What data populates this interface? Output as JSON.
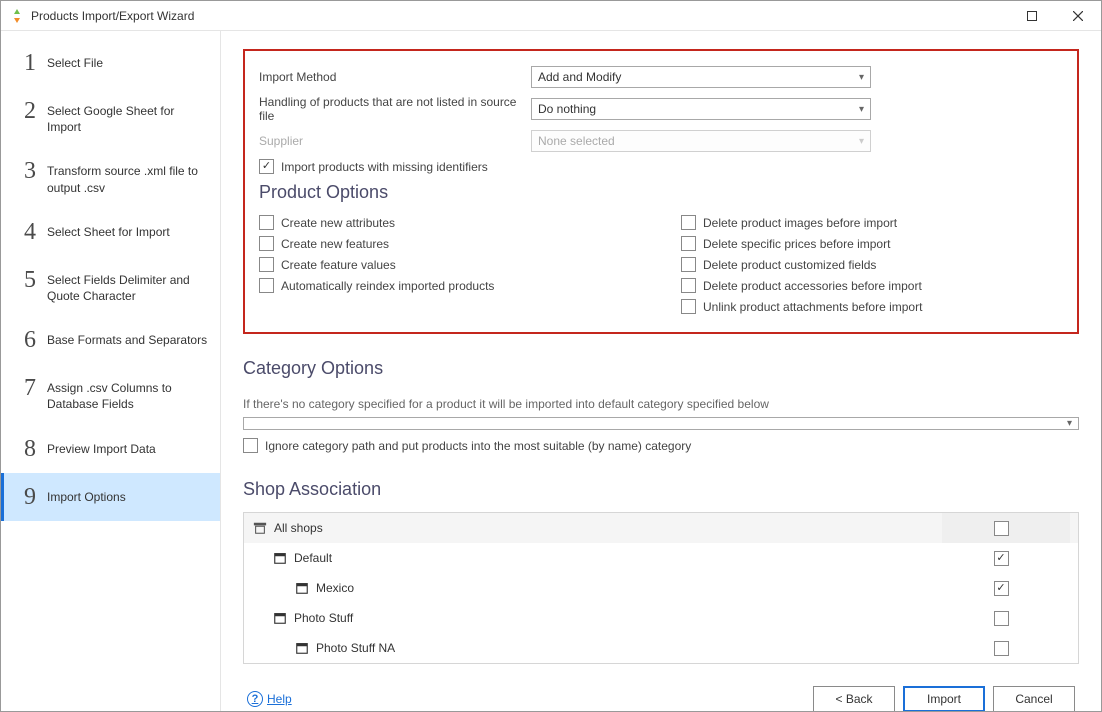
{
  "window": {
    "title": "Products Import/Export Wizard"
  },
  "steps": [
    {
      "num": "1",
      "label": "Select File"
    },
    {
      "num": "2",
      "label": "Select Google Sheet for Import"
    },
    {
      "num": "3",
      "label": "Transform source .xml file to output .csv"
    },
    {
      "num": "4",
      "label": "Select Sheet for Import"
    },
    {
      "num": "5",
      "label": "Select Fields Delimiter and Quote Character"
    },
    {
      "num": "6",
      "label": "Base Formats and Separators"
    },
    {
      "num": "7",
      "label": "Assign .csv Columns to Database Fields"
    },
    {
      "num": "8",
      "label": "Preview Import Data"
    },
    {
      "num": "9",
      "label": "Import Options"
    }
  ],
  "import": {
    "method_label": "Import Method",
    "method_value": "Add and Modify",
    "handling_label": "Handling of products that are not listed in source file",
    "handling_value": "Do nothing",
    "supplier_label": "Supplier",
    "supplier_value": "None selected",
    "missing_ids_label": "Import products with missing identifiers"
  },
  "product_options": {
    "heading": "Product Options",
    "left": [
      "Create new attributes",
      "Create new features",
      "Create feature values",
      "Automatically reindex imported products"
    ],
    "right": [
      "Delete product images before import",
      "Delete specific prices before import",
      "Delete product customized fields",
      "Delete product accessories before import",
      "Unlink product attachments before import"
    ]
  },
  "category": {
    "heading": "Category Options",
    "helper": "If there's no category specified for a product it will be imported into default category specified below",
    "ignore_path_label": "Ignore category path and put products into the most suitable (by name) category"
  },
  "shop": {
    "heading": "Shop Association",
    "rows": [
      {
        "label": "All shops",
        "indent": 0,
        "checked": false,
        "shaded": true
      },
      {
        "label": "Default",
        "indent": 1,
        "checked": true,
        "shaded": false
      },
      {
        "label": "Mexico",
        "indent": 2,
        "checked": true,
        "shaded": false
      },
      {
        "label": "Photo Stuff",
        "indent": 1,
        "checked": false,
        "shaded": false
      },
      {
        "label": "Photo Stuff NA",
        "indent": 2,
        "checked": false,
        "shaded": false
      }
    ]
  },
  "footer": {
    "help": "Help",
    "back": "< Back",
    "import": "Import",
    "cancel": "Cancel"
  }
}
